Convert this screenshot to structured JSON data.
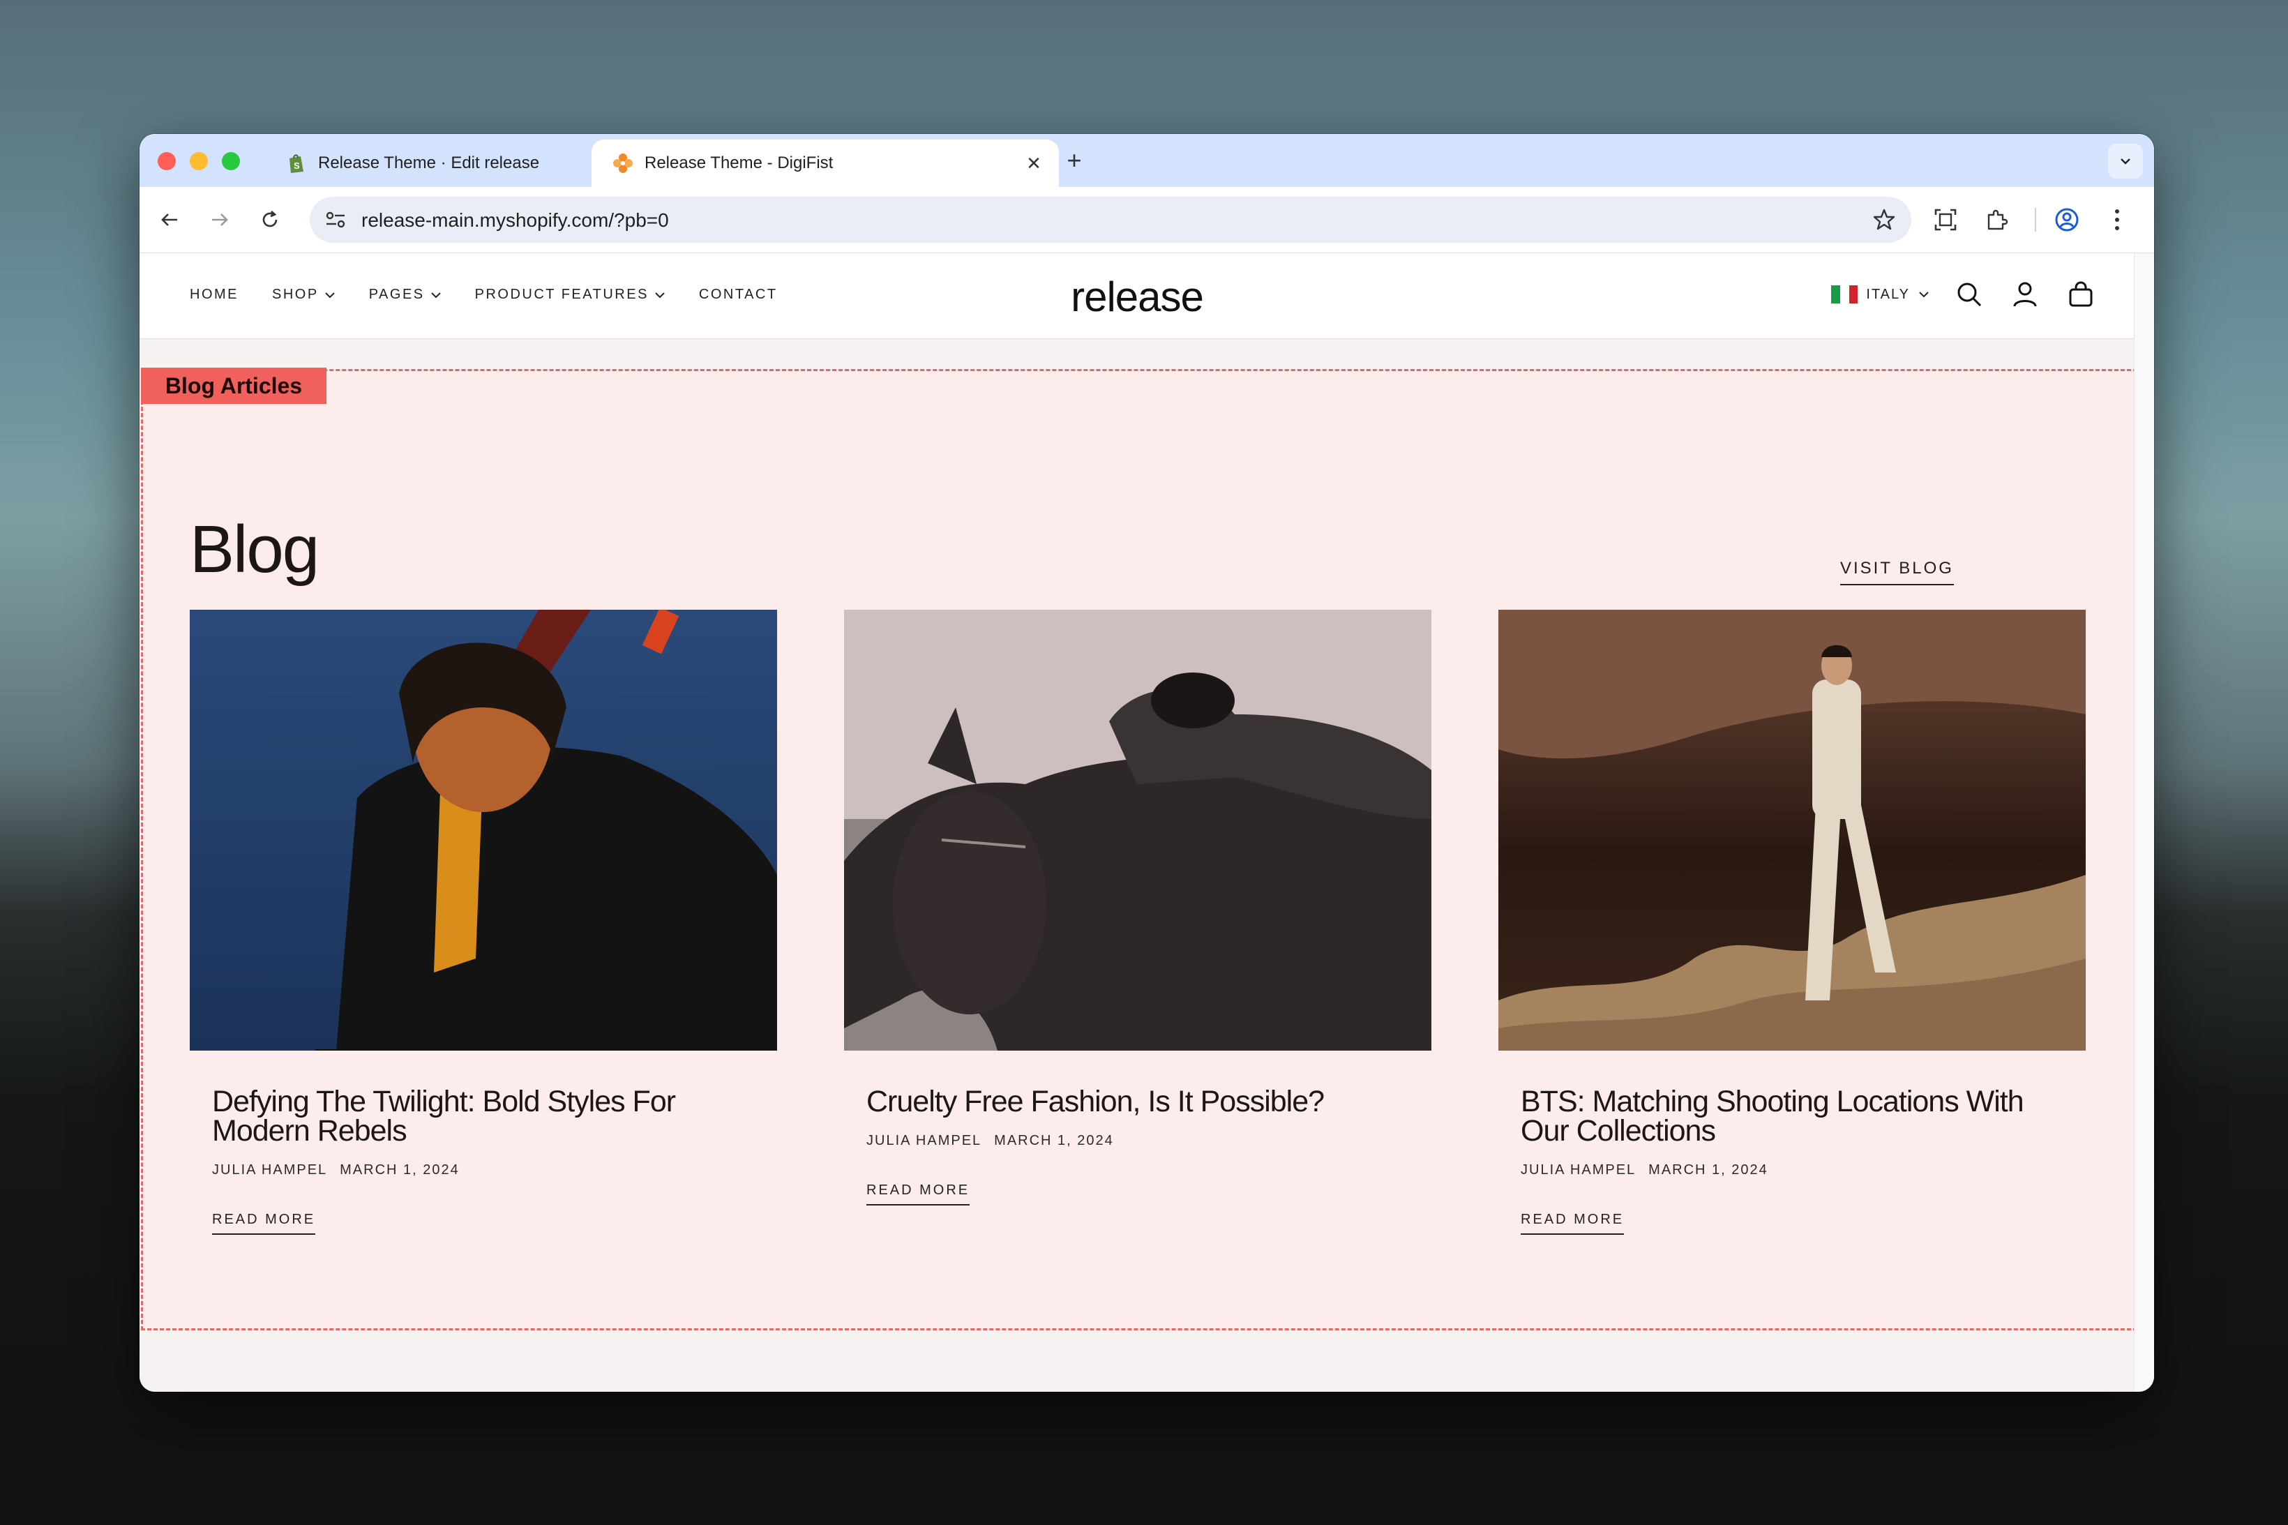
{
  "browser": {
    "tabs": [
      {
        "title": "Release Theme · Edit release",
        "favicon": "shopify-icon",
        "active": false
      },
      {
        "title": "Release Theme - DigiFist",
        "favicon": "digifist-icon",
        "active": true
      }
    ],
    "url": "release-main.myshopify.com/?pb=0"
  },
  "header": {
    "nav": [
      "HOME",
      "SHOP",
      "PAGES",
      "PRODUCT FEATURES",
      "CONTACT"
    ],
    "logo": "release",
    "locale": "ITALY"
  },
  "section": {
    "tag": "Blog Articles",
    "title": "Blog",
    "visit_label": "VISIT BLOG"
  },
  "articles": [
    {
      "title": "Defying The Twilight: Bold Styles For Modern Rebels",
      "author": "JULIA HAMPEL",
      "date": "MARCH 1, 2024",
      "cta": "READ MORE"
    },
    {
      "title": "Cruelty Free Fashion, Is It Possible?",
      "author": "JULIA HAMPEL",
      "date": "MARCH 1, 2024",
      "cta": "READ MORE"
    },
    {
      "title": "BTS: Matching Shooting Locations With Our Collections",
      "author": "JULIA HAMPEL",
      "date": "MARCH 1, 2024",
      "cta": "READ MORE"
    }
  ],
  "colors": {
    "section_bg": "#fdecec",
    "tag_bg": "#f0605d",
    "dashed_border": "#e06a6a",
    "tab_strip": "#d3e3fd"
  }
}
